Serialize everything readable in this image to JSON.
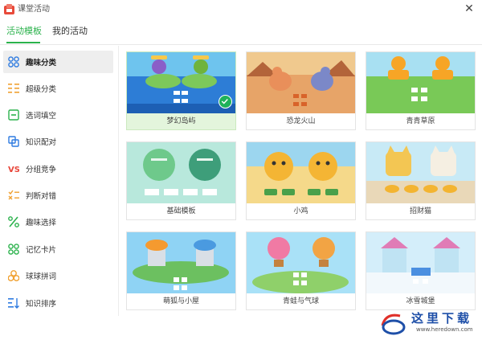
{
  "window": {
    "title": "课堂活动"
  },
  "tabs": [
    {
      "label": "活动模板",
      "active": true
    },
    {
      "label": "我的活动",
      "active": false
    }
  ],
  "sidebar": {
    "items": [
      {
        "label": "趣味分类",
        "icon": "grid-icon",
        "active": true
      },
      {
        "label": "超级分类",
        "icon": "list-split-icon",
        "active": false
      },
      {
        "label": "选词填空",
        "icon": "fill-blank-icon",
        "active": false
      },
      {
        "label": "知识配对",
        "icon": "pair-icon",
        "active": false
      },
      {
        "label": "分组竞争",
        "icon": "vs-icon",
        "active": false
      },
      {
        "label": "判断对错",
        "icon": "true-false-icon",
        "active": false
      },
      {
        "label": "趣味选择",
        "icon": "percent-icon",
        "active": false
      },
      {
        "label": "记忆卡片",
        "icon": "memory-card-icon",
        "active": false
      },
      {
        "label": "球球拼词",
        "icon": "balls-icon",
        "active": false
      },
      {
        "label": "知识排序",
        "icon": "sort-icon",
        "active": false
      }
    ]
  },
  "templates": [
    {
      "label": "梦幻岛屿",
      "selected": true
    },
    {
      "label": "恐龙火山",
      "selected": false
    },
    {
      "label": "青青草原",
      "selected": false
    },
    {
      "label": "基础模板",
      "selected": false
    },
    {
      "label": "小鸡",
      "selected": false
    },
    {
      "label": "招财猫",
      "selected": false
    },
    {
      "label": "萌狐与小屋",
      "selected": false
    },
    {
      "label": "青蛙与气球",
      "selected": false
    },
    {
      "label": "冰雪城堡",
      "selected": false
    }
  ],
  "colors": {
    "accent": "#2bb24c",
    "selected_bg": "#e3f5dc",
    "check": "#1fb25a"
  },
  "watermark": {
    "text": "这里下载",
    "url": "www.heredown.com"
  }
}
